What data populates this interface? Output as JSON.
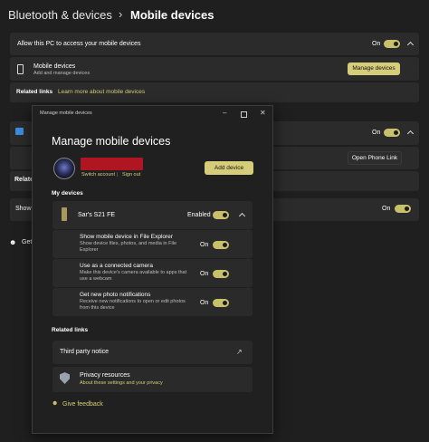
{
  "header": {
    "breadcrumb_parent": "Bluetooth & devices",
    "separator": "›",
    "title": "Mobile devices"
  },
  "settings": {
    "allow_label": "Allow this PC to access your mobile devices",
    "allow_state": "On",
    "mobile_devices_label": "Mobile devices",
    "mobile_devices_sub": "Add and manage devices",
    "manage_button": "Manage devices",
    "related_links_label": "Related links",
    "learn_more_link": "Learn more about mobile devices",
    "phone_link_state": "On",
    "open_phone_link_button": "Open Phone Link",
    "related_partial": "Relate",
    "show_partial": "Show",
    "show_state": "On",
    "get_partial": "Get"
  },
  "dialog": {
    "window_title": "Manage mobile devices",
    "heading": "Manage mobile devices",
    "switch_account": "Switch account",
    "divider": "|",
    "sign_out": "Sign out",
    "add_device_button": "Add device",
    "my_devices_label": "My devices",
    "device_name": "Sar's S21 FE",
    "device_state": "Enabled",
    "options": [
      {
        "title": "Show mobile device in File Explorer",
        "desc_lines": [
          "Show device files, photos, and media in File",
          "Explorer"
        ],
        "state": "On"
      },
      {
        "title": "Use as a connected camera",
        "desc_lines": [
          "Make this device's camera available to apps that",
          "use a webcam"
        ],
        "state": "On"
      },
      {
        "title": "Get new photo notifications",
        "desc_lines": [
          "Receive new notifications to open or edit photos",
          "from this device"
        ],
        "state": "On"
      }
    ],
    "related_links_label": "Related links",
    "third_party_notice": "Third party notice",
    "privacy_title": "Privacy resources",
    "privacy_link": "About these settings and your privacy",
    "feedback": "Give feedback"
  },
  "colors": {
    "accent": "#c8c06a",
    "background": "#1f1f1f",
    "dialog": "#202020",
    "card": "#2b2b2b",
    "redacted": "#b01622"
  }
}
